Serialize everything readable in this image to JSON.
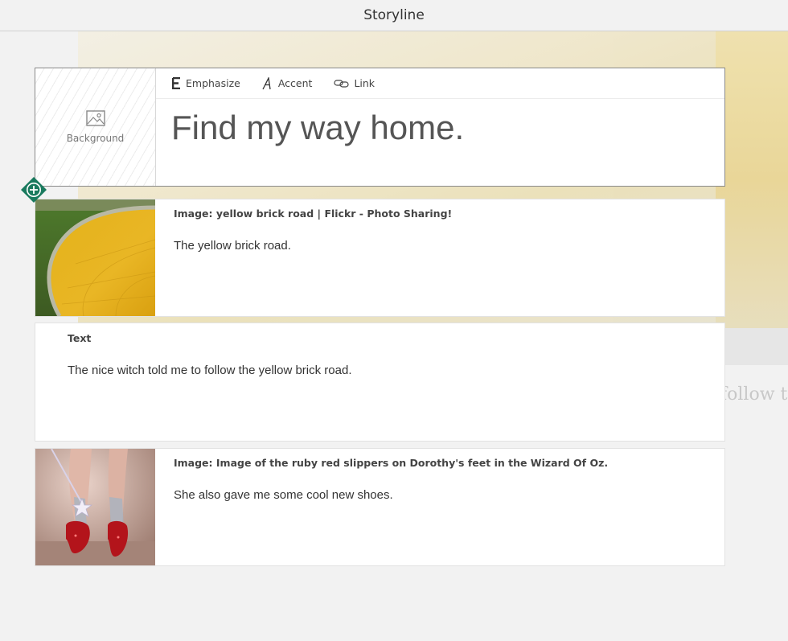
{
  "app": {
    "title": "Storyline"
  },
  "background_preview": {
    "peek_text": "follow th"
  },
  "title_card": {
    "background_label": "Background",
    "toolbar": [
      {
        "label": "Emphasize",
        "icon": "emphasize-icon"
      },
      {
        "label": "Accent",
        "icon": "accent-icon"
      },
      {
        "label": "Link",
        "icon": "link-icon"
      }
    ],
    "headline": "Find my way home."
  },
  "add_button": {
    "icon": "plus-icon",
    "color": "#1a7a5e"
  },
  "cards": [
    {
      "type": "image",
      "label": "Image: yellow brick road | Flickr - Photo Sharing!",
      "text": "The yellow brick road.",
      "thumbnail": "yellow-brick-road-photo"
    },
    {
      "type": "text",
      "label": "Text",
      "text": "The nice witch told me to follow the yellow brick road."
    },
    {
      "type": "image",
      "label": "Image: Image of the ruby red slippers on Dorothy's feet in the Wizard Of Oz.",
      "text": "She also gave me some cool new shoes.",
      "thumbnail": "ruby-slippers-photo"
    }
  ],
  "colors": {
    "accent": "#1a7a5e",
    "background": "#f2f2f2"
  }
}
